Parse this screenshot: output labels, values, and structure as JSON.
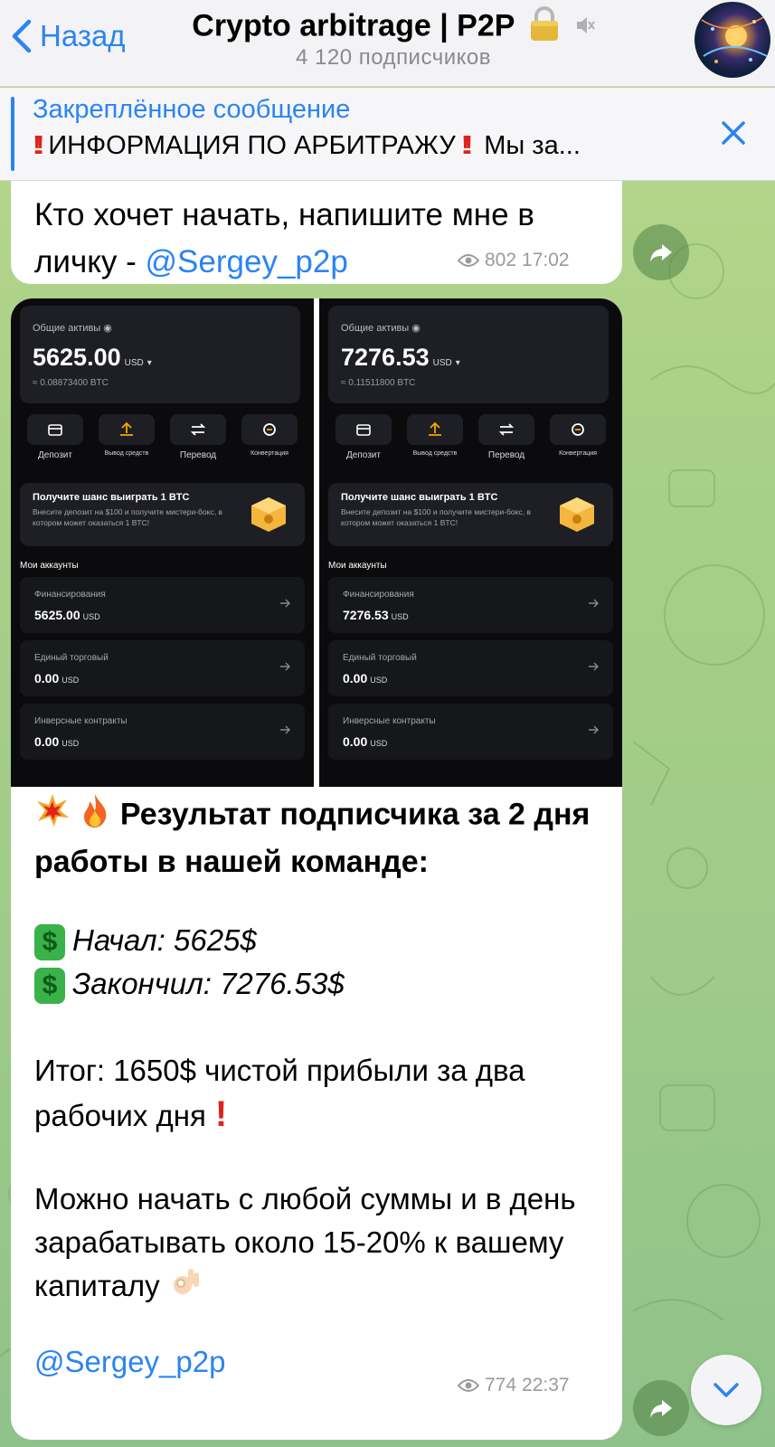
{
  "header": {
    "back_label": "Назад",
    "title": "Crypto arbitrage | P2P",
    "subscribers": "4 120 подписчиков"
  },
  "pinned": {
    "title": "Закреплённое сообщение",
    "text": "ИНФОРМАЦИЯ ПО АРБИТРАЖУ",
    "tail": "Мы за..."
  },
  "message1": {
    "text": "Кто хочет начать, напишите мне в личку - ",
    "link": "@Sergey_p2p",
    "views": "802",
    "time": "17:02"
  },
  "screenshots": [
    {
      "assets_label": "Общие активы",
      "assets_value": "5625.00",
      "assets_currency": "USD",
      "assets_btc": "≈ 0.08873400 BTC",
      "actions": [
        "Депозит",
        "Вывод средств",
        "Перевод",
        "Конвертация"
      ],
      "promo_title": "Получите шанс выиграть 1 BTC",
      "promo_desc": "Внесите депозит на $100 и получите мистери-бокс, в котором может оказаться 1 BTC!",
      "accounts_header": "Мои аккаунты",
      "accounts": [
        {
          "name": "Финансирования",
          "value": "5625.00",
          "currency": "USD"
        },
        {
          "name": "Единый торговый",
          "value": "0.00",
          "currency": "USD"
        },
        {
          "name": "Инверсные контракты",
          "value": "0.00",
          "currency": "USD"
        }
      ]
    },
    {
      "assets_label": "Общие активы",
      "assets_value": "7276.53",
      "assets_currency": "USD",
      "assets_btc": "≈ 0.11511800 BTC",
      "actions": [
        "Депозит",
        "Вывод средств",
        "Перевод",
        "Конвертация"
      ],
      "promo_title": "Получите шанс выиграть 1 BTC",
      "promo_desc": "Внесите депозит на $100 и получите мистери-бокс, в котором может оказаться 1 BTC!",
      "accounts_header": "Мои аккаунты",
      "accounts": [
        {
          "name": "Финансирования",
          "value": "7276.53",
          "currency": "USD"
        },
        {
          "name": "Единый торговый",
          "value": "0.00",
          "currency": "USD"
        },
        {
          "name": "Инверсные контракты",
          "value": "0.00",
          "currency": "USD"
        }
      ]
    }
  ],
  "message2": {
    "headline": "Результат подписчика за 2 дня работы в нашей команде:",
    "started": "Начал: 5625$",
    "finished": "Закончил: 7276.53$",
    "result": "Итог: 1650$ чистой прибыли за два рабочих дня",
    "pitch": "Можно начать с любой суммы и в день зарабатывать около 15-20% к вашему капиталу",
    "link": "@Sergey_p2p",
    "views": "774",
    "time": "22:37"
  },
  "colors": {
    "accent": "#2b84f2",
    "bubble": "#ffffff",
    "wallpaper": "#a7cf86",
    "alert_red": "#e0221d"
  }
}
